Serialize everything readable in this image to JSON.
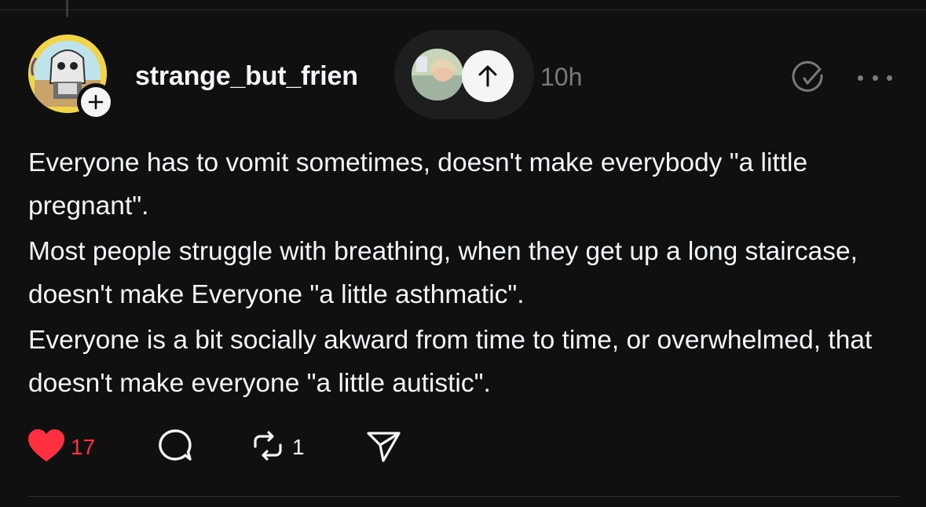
{
  "post": {
    "username": "strange_but_frien",
    "timestamp": "10h",
    "paragraphs": [
      "Everyone has to vomit sometimes, doesn't make everybody \"a little pregnant\".",
      "Most people struggle with breathing, when they get up a long staircase, doesn't make Everyone \"a little asthmatic\".",
      "Everyone is a bit socially akward from time to time, or overwhelmed, that doesn't make everyone \"a little autistic\"."
    ],
    "likes": "17",
    "reposts": "1"
  },
  "icons": {
    "follow": "plus-icon",
    "scroll_up": "arrow-up-icon",
    "translate": "translate-icon",
    "more": "more-horizontal-icon",
    "like": "heart-icon",
    "comment": "comment-icon",
    "repost": "repost-icon",
    "share": "send-icon"
  },
  "colors": {
    "background": "#101010",
    "text": "#f3f5f7",
    "muted": "#7a7a7a",
    "like_active": "#ff3040"
  }
}
